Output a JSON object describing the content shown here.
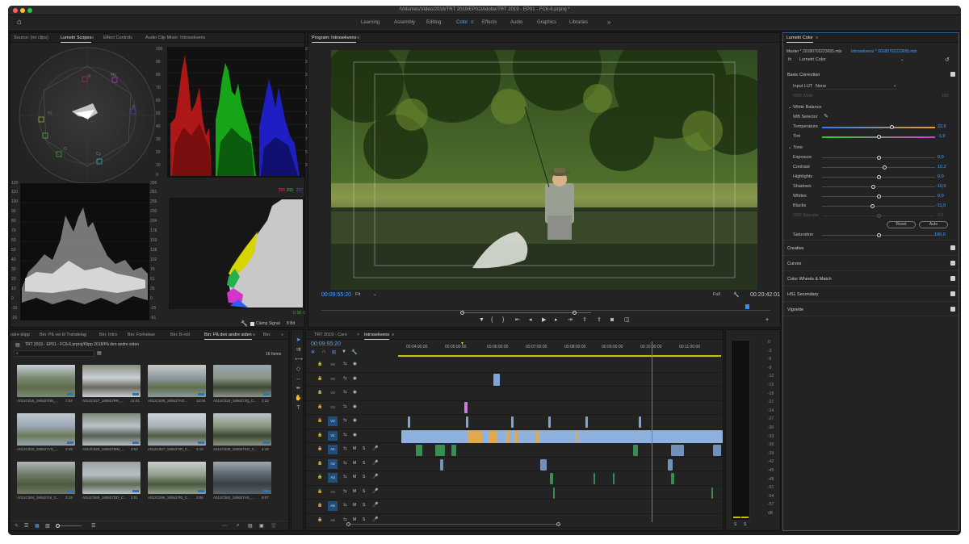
{
  "titlebar": {
    "title": "/Volumes/Video/2018/TRT 2019/EP02/Adobe/TRT 2019 - EP01 - FC6-6.prproj *"
  },
  "workspaces": {
    "items": [
      "Learning",
      "Assembly",
      "Editing",
      "Color",
      "Effects",
      "Audio",
      "Graphics",
      "Libraries"
    ],
    "active": "Color",
    "overflow": "»"
  },
  "scopes": {
    "tabs": [
      "Source: (no clips)",
      "Lumetri Scopes",
      "Effect Controls",
      "Audio Clip Mixer: Introsekvens"
    ],
    "parade_scale": [
      "100",
      "90",
      "80",
      "70",
      "60",
      "50",
      "40",
      "30",
      "20",
      "10",
      "0"
    ],
    "parade_scale_right": [
      "255",
      "230",
      "204",
      "178",
      "153",
      "128",
      "102",
      "76",
      "51",
      "26",
      "0"
    ],
    "wave_scale": [
      "120",
      "110",
      "100",
      "90",
      "80",
      "70",
      "60",
      "50",
      "40",
      "30",
      "20",
      "10",
      "0",
      "-10",
      "-20"
    ],
    "wave_scale_right": [
      "306",
      "281",
      "255",
      "230",
      "204",
      "178",
      "153",
      "128",
      "102",
      "76",
      "51",
      "26",
      "0",
      "-25",
      "-51"
    ],
    "hist_top": [
      "255",
      "255",
      "237"
    ],
    "hist_bottom": [
      "11",
      "16",
      "0"
    ],
    "clamp_label": "Clamp Signal",
    "bit_label": "8 Bit",
    "vector_labels": [
      "R",
      "Mg",
      "B",
      "Cy",
      "G",
      "YL"
    ]
  },
  "program": {
    "tab": "Program: Introsekvens",
    "timecode": "00:09:55:20",
    "fit": "Fit",
    "quality": "Full",
    "duration": "00:20:42:01"
  },
  "lumetri": {
    "tab": "Lumetri Color",
    "master": "Master * 20180702223655.mts",
    "clip": "Introsekvens * 20180702223655.mts",
    "effect": "Lumetri Color",
    "basic": "Basic Correction",
    "input_lut_label": "Input LUT",
    "input_lut_value": "None",
    "hdr_white": "HDR White",
    "hdr_white_value": "100",
    "wb": "White Balance",
    "wb_selector": "WB Selector",
    "temperature": {
      "label": "Temperature",
      "value": "22,6"
    },
    "tint": {
      "label": "Tint",
      "value": "-1,9"
    },
    "tone": "Tone",
    "tones": [
      {
        "label": "Exposure",
        "value": "0,0"
      },
      {
        "label": "Contrast",
        "value": "10,2"
      },
      {
        "label": "Highlights",
        "value": "0,0"
      },
      {
        "label": "Shadows",
        "value": "-10,0"
      },
      {
        "label": "Whites",
        "value": "0,0"
      },
      {
        "label": "Blacks",
        "value": "-11,0"
      },
      {
        "label": "HDR Specular",
        "value": "0,0"
      }
    ],
    "reset": "Reset",
    "auto": "Auto",
    "saturation": {
      "label": "Saturation",
      "value": "100,0"
    },
    "sections": [
      "Creative",
      "Curves",
      "Color Wheels & Match",
      "HSL Secondary",
      "Vignette"
    ]
  },
  "bins": {
    "tabs": [
      "ndre klipp",
      "Bin: På vei til Trøndelag",
      "Bin: Intro",
      "Bin: Forhekse",
      "Bin: B-roll",
      "Bin: På den andre siden",
      "Bin:"
    ],
    "path": "TRT 2019 - EP01 - FC6-6.prproj/Klipp 2018/På den andre siden",
    "count": "16 Items",
    "clips": [
      {
        "name": "A012C019_180627DN_...",
        "dur": "7:24"
      },
      {
        "name": "A012C027_180627RR_...",
        "dur": "11:01"
      },
      {
        "name": "A012C028_180627AO...",
        "dur": "12:00"
      },
      {
        "name": "A012C018_180627JQ_C...",
        "dur": "2:22"
      },
      {
        "name": "A012C020_180627VS_...",
        "dur": "3:19"
      },
      {
        "name": "A012C026_180627MM_...",
        "dur": "3:04"
      },
      {
        "name": "A012C027_180627IR_C...",
        "dur": "4:10"
      },
      {
        "name": "A012C030_180627SO_C...",
        "dur": "4:18"
      },
      {
        "name": "A012C084_180627UI_C...",
        "dur": "3:19"
      },
      {
        "name": "A012C089_180627DD_C...",
        "dur": "3:01"
      },
      {
        "name": "A012C086_180627RI_C...",
        "dur": "3:06"
      },
      {
        "name": "A012C062_180627HS_...",
        "dur": "5:07"
      }
    ]
  },
  "timeline": {
    "tabs": [
      "TRT 2019 - Core",
      "Introsekvens"
    ],
    "timecode": "00:09:55:20",
    "ruler": [
      "00:04:00:00",
      "00:05:00:00",
      "00:06:00:00",
      "00:07:00:00",
      "00:08:00:00",
      "00:09:00:00",
      "00:10:00:00",
      "00:11:00:00"
    ],
    "video_tracks": [
      "V6",
      "V5",
      "V4",
      "V3",
      "V2",
      "V1"
    ],
    "audio_tracks": [
      "A1",
      "A2",
      "A3",
      "A4",
      "A5",
      "A6"
    ]
  },
  "meter": {
    "scale": [
      "0",
      "-3",
      "-6",
      "-9",
      "-12",
      "-15",
      "-18",
      "-21",
      "-24",
      "-27",
      "-30",
      "-33",
      "-36",
      "-39",
      "-42",
      "-45",
      "-48",
      "-51",
      "-54",
      "-57",
      "dB"
    ],
    "bottom": [
      "S",
      "S"
    ]
  }
}
